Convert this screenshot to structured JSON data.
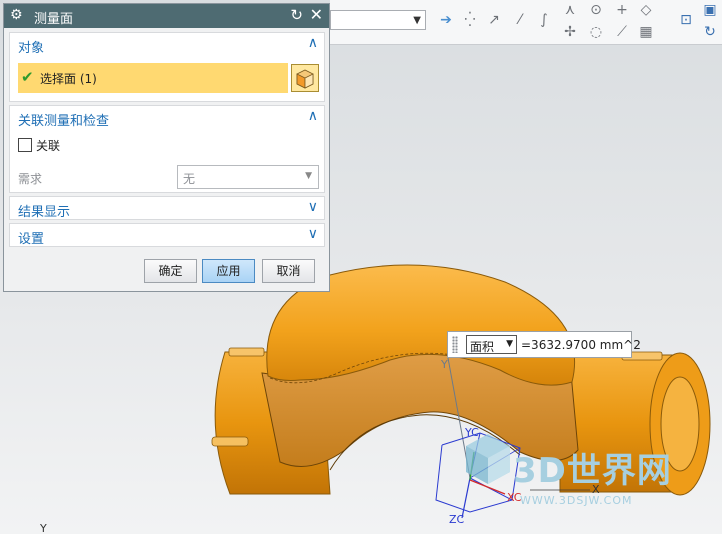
{
  "dialog": {
    "title": "测量面",
    "sections": {
      "object": {
        "label": "对象",
        "selected_item": "选择面 (1)"
      },
      "association": {
        "label": "关联测量和检查",
        "checkbox_label": "关联",
        "checked": false,
        "requirement_label": "需求",
        "requirement_value": "无"
      },
      "result_display": {
        "label": "结果显示"
      },
      "settings": {
        "label": "设置"
      }
    },
    "buttons": {
      "ok": "确定",
      "apply": "应用",
      "cancel": "取消"
    }
  },
  "measurement": {
    "type_value": "面积",
    "result": "=3632.9700 mm^2"
  },
  "axes": {
    "yc": "YC",
    "xc": "XC",
    "zc": "ZC",
    "x": "X",
    "y": "Y"
  },
  "watermark": {
    "text": "3D世界网",
    "url": "WWW.3DSJW.COM"
  },
  "colors": {
    "title_bar": "#4e6b72",
    "section_header": "#1f6fb5",
    "selection_highlight": "#ffd971",
    "model": "#f2a21c"
  }
}
